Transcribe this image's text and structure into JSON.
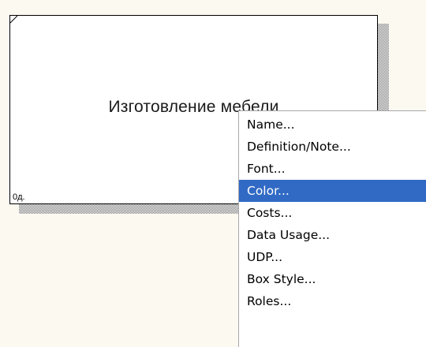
{
  "diagram": {
    "activity_box": {
      "title": "Изготовление мебели",
      "node_label": "0д."
    }
  },
  "context_menu": {
    "selected_index": 3,
    "items": [
      {
        "label": "Name..."
      },
      {
        "label": "Definition/Note..."
      },
      {
        "label": "Font..."
      },
      {
        "label": "Color..."
      },
      {
        "label": "Costs..."
      },
      {
        "label": "Data Usage..."
      },
      {
        "label": "UDP..."
      },
      {
        "label": "Box Style..."
      },
      {
        "label": "Roles..."
      }
    ]
  },
  "colors": {
    "canvas_background": "#fcf9f1",
    "selection_highlight": "#316ac5",
    "shadow_hatch": "#7c7c7c"
  }
}
